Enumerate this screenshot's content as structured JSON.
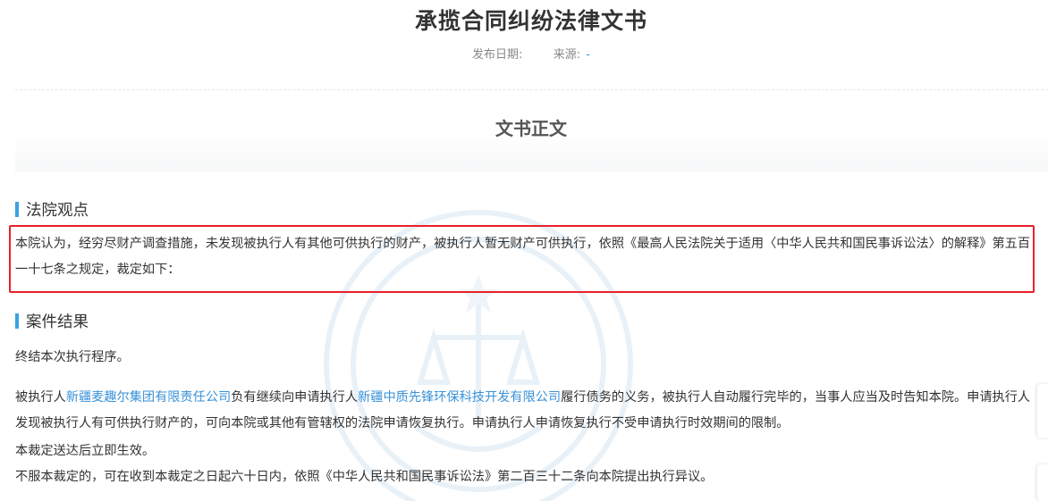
{
  "header": {
    "title": "承揽合同纠纷法律文书",
    "publish_date_label": "发布日期:",
    "source_label": "来源:",
    "source_value": "-"
  },
  "banner": {
    "title": "文书正文"
  },
  "court_opinion": {
    "heading": "法院观点",
    "text": "本院认为，经穷尽财产调查措施，未发现被执行人有其他可供执行的财产，被执行人暂无财产可供执行，依照《最高人民法院关于适用〈中华人民共和国民事诉讼法〉的解释》第五百一十七条之规定，裁定如下："
  },
  "case_result": {
    "heading": "案件结果",
    "line1": "终结本次执行程序。",
    "para2": {
      "prefix": "被执行人",
      "respondent": "新疆麦趣尔集团有限责任公司",
      "middle": "负有继续向申请执行人",
      "applicant": "新疆中质先锋环保科技开发有限公司",
      "suffix": "履行债务的义务，被执行人自动履行完毕的，当事人应当及时告知本院。申请执行人发现被执行人有可供执行财产的，可向本院或其他有管辖权的法院申请恢复执行。申请执行人申请恢复执行不受申请执行时效期间的限制。"
    },
    "line3": "本裁定送达后立即生效。",
    "line4": "不服本裁定的，可在收到本裁定之日起六十日内，依照《中华人民共和国民事诉讼法》第二百三十二条向本院提出执行异议。"
  },
  "colors": {
    "accent": "#3ba1e4",
    "link": "#3a92d8",
    "highlight_border": "#e8212a"
  },
  "icons": {
    "watermark": "court-emblem-icon"
  }
}
